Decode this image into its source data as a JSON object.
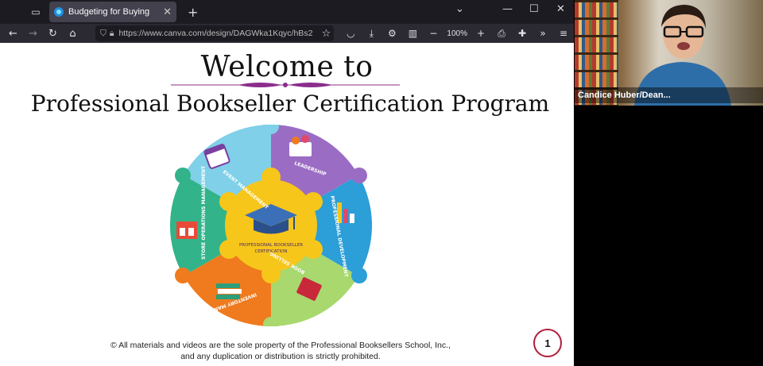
{
  "browser": {
    "tab_title": "Budgeting for Buying",
    "url": "https://www.canva.com/design/DAGWka1Kqyc/hBs2",
    "zoom": "100%"
  },
  "slide": {
    "heading": "Welcome to",
    "subheading": "Professional Bookseller Certification Program",
    "wheel": {
      "center_label_line1": "PROFESSIONAL BOOKSELLER",
      "center_label_line2": "CERTIFICATION",
      "segments": [
        {
          "label": "LEADERSHIP",
          "color": "#9b6cc4"
        },
        {
          "label": "PROFESSIONAL DEVELOPMENT",
          "color": "#2c9ed8"
        },
        {
          "label": "BOOK SELLING",
          "color": "#a8d86e"
        },
        {
          "label": "INVENTORY MANAGEMENT",
          "color": "#f07a1e"
        },
        {
          "label": "STORE OPERATIONS MANAGEMENT",
          "color": "#32b38a"
        },
        {
          "label": "EVENT MANAGEMENT",
          "color": "#7fd0e8"
        }
      ]
    },
    "copyright_line1": "© All materials and videos are the sole property of the Professional Booksellers School, Inc.,",
    "copyright_line2": "and any duplication or distribution is strictly prohibited.",
    "page_number": "1"
  },
  "video": {
    "participant_name": "Candice Huber/Dean..."
  },
  "colors": {
    "ornament": "#8a2d8c",
    "page_circle": "#b01e3a",
    "wheel_center": "#f7c61b"
  }
}
